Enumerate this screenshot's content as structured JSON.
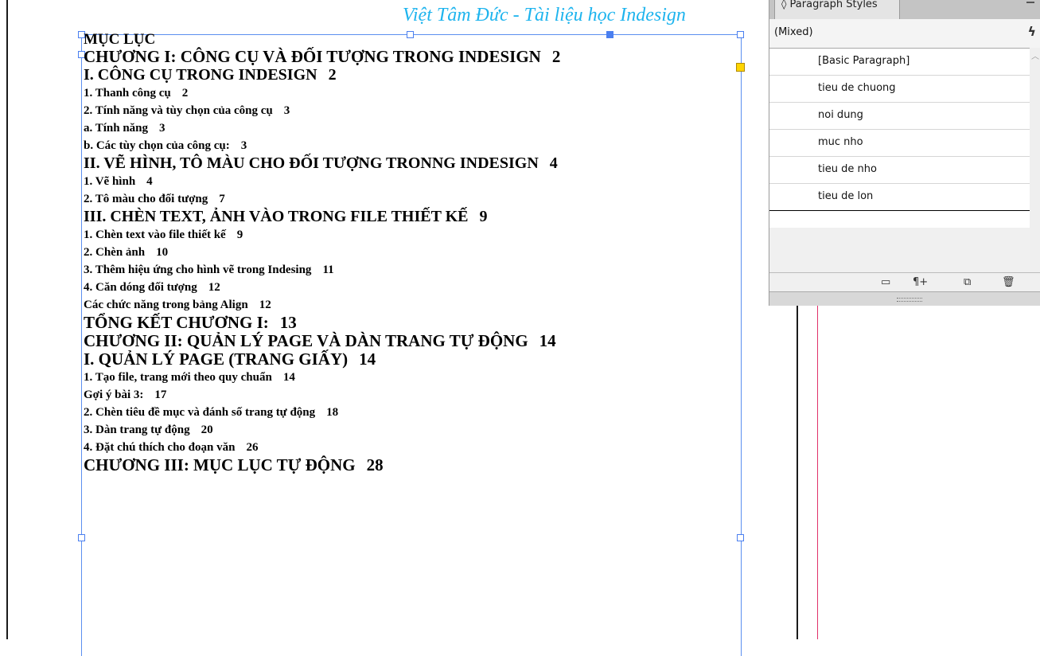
{
  "header": {
    "text": "Việt Tâm Đức - Tài liệu học Indesign"
  },
  "toc": {
    "lines": [
      {
        "text": "MỤC LỤC",
        "num": "",
        "level": "title"
      },
      {
        "text": "CHƯƠNG I: CÔNG CỤ VÀ ĐỐI TƯỢNG TRONG INDESIGN",
        "num": "2",
        "level": "chapter"
      },
      {
        "text": "I. CÔNG CỤ TRONG INDESIGN",
        "num": "2",
        "level": "section"
      },
      {
        "text": "1. Thanh công cụ",
        "num": "2",
        "level": "item"
      },
      {
        "text": "2. Tính năng và tùy chọn của công cụ",
        "num": "3",
        "level": "item"
      },
      {
        "text": "a. Tính năng",
        "num": "3",
        "level": "item"
      },
      {
        "text": "b. Các tùy chọn của công cụ:",
        "num": "3",
        "level": "item"
      },
      {
        "text": "II. VẼ HÌNH, TÔ MÀU CHO ĐỐI TƯỢNG TRONNG INDESIGN",
        "num": "4",
        "level": "section"
      },
      {
        "text": "1. Vẽ hình",
        "num": "4",
        "level": "item"
      },
      {
        "text": "2. Tô màu cho đối tượng",
        "num": "7",
        "level": "item"
      },
      {
        "text": "III. CHÈN TEXT, ẢNH VÀO TRONG FILE THIẾT KẾ",
        "num": "9",
        "level": "section"
      },
      {
        "text": "1. Chèn text vào file thiết kế",
        "num": "9",
        "level": "item"
      },
      {
        "text": "2. Chèn ảnh",
        "num": "10",
        "level": "item"
      },
      {
        "text": "3. Thêm hiệu ứng cho hình vẽ trong Indesing",
        "num": "11",
        "level": "item"
      },
      {
        "text": "4. Căn dóng đối tượng",
        "num": "12",
        "level": "item"
      },
      {
        "text": "Các chức năng trong bảng Align",
        "num": "12",
        "level": "item"
      },
      {
        "text": "TỔNG KẾT CHƯƠNG I:",
        "num": "13",
        "level": "chapter"
      },
      {
        "text": "CHƯƠNG II: QUẢN LÝ PAGE VÀ DÀN TRANG TỰ ĐỘNG",
        "num": "14",
        "level": "chapter"
      },
      {
        "text": "I. QUẢN LÝ PAGE (TRANG GIẤY)",
        "num": "14",
        "level": "chapter"
      },
      {
        "text": "1. Tạo file, trang mới theo quy chuẩn",
        "num": "14",
        "level": "item"
      },
      {
        "text": "Gợi ý bài 3:",
        "num": "17",
        "level": "item"
      },
      {
        "text": "2. Chèn tiêu đề mục và đánh số trang tự động",
        "num": "18",
        "level": "item"
      },
      {
        "text": "3. Dàn trang tự động",
        "num": "20",
        "level": "item"
      },
      {
        "text": "4. Đặt chú thích cho đoạn văn",
        "num": "26",
        "level": "item"
      },
      {
        "text": "CHƯƠNG III: MỤC LỤC TỰ ĐỘNG",
        "num": "28",
        "level": "chapter"
      }
    ]
  },
  "panel": {
    "tab_label": "◊ Paragraph Styles",
    "current_style": "(Mixed)",
    "styles": [
      "[Basic Paragraph]",
      "tieu de chuong",
      "noi dung",
      "muc nho",
      "tieu de nho",
      "tieu de lon"
    ],
    "footer_icons": [
      "folder-icon",
      "new-style-override-icon",
      "new-style-icon",
      "trash-icon"
    ]
  },
  "colors": {
    "header": "#1eb4ee",
    "frame": "#5b8ff0",
    "margin_guide": "#e0316a"
  }
}
